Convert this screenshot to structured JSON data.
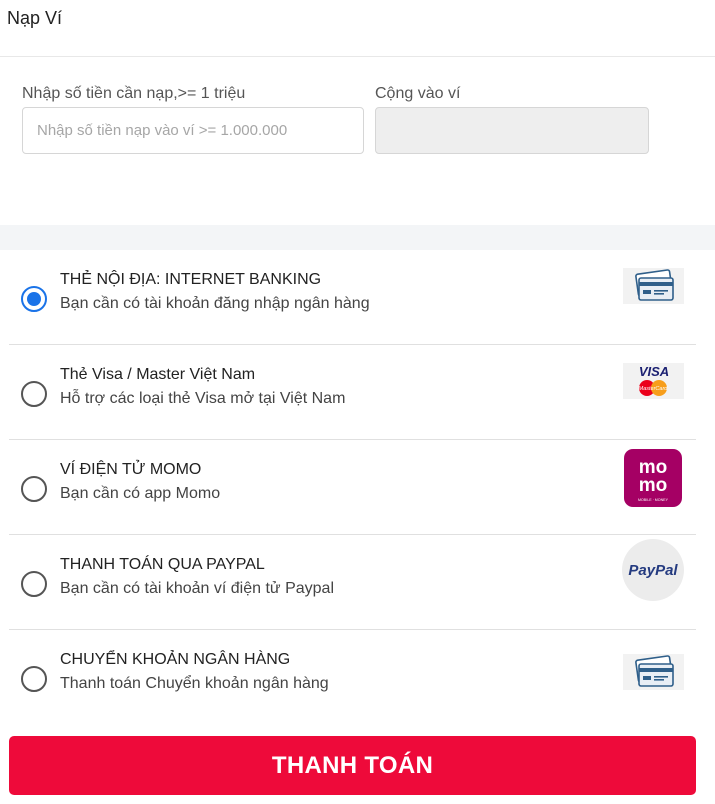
{
  "header": {
    "title": "Nạp Ví"
  },
  "amount": {
    "label": "Nhập số tiền cần nạp,>= 1 triệu",
    "placeholder": "Nhập số tiền nạp vào ví >= 1.000.000",
    "value": ""
  },
  "added": {
    "label": "Cộng vào ví",
    "value": ""
  },
  "methods": [
    {
      "title": "THẺ NỘI ĐỊA: INTERNET BANKING",
      "desc": "Bạn cần có tài khoản đăng nhập ngân hàng",
      "icon": "bank-card-icon",
      "selected": true
    },
    {
      "title": "Thẻ Visa / Master Việt Nam",
      "desc": "Hỗ trợ các loại thẻ Visa mở tại Việt Nam",
      "icon": "visa-mastercard-icon",
      "selected": false,
      "icon_text": {
        "top": "VISA",
        "bottom": "MasterCard"
      }
    },
    {
      "title": "VÍ ĐIỆN TỬ MOMO",
      "desc": "Bạn cần có app Momo",
      "icon": "momo-icon",
      "selected": false,
      "icon_text": {
        "line1": "mo",
        "line2": "mo",
        "tagline": "MOBILE · MONEY"
      }
    },
    {
      "title": "THANH TOÁN QUA PAYPAL",
      "desc": "Bạn cần có tài khoản ví điện tử Paypal",
      "icon": "paypal-icon",
      "selected": false,
      "icon_text": {
        "brand": "PayPal"
      }
    },
    {
      "title": "CHUYỂN KHOẢN NGÂN HÀNG",
      "desc": "Thanh toán Chuyển khoản ngân hàng",
      "icon": "bank-card-icon",
      "selected": false
    }
  ],
  "pay_button": {
    "label": "THANH TOÁN"
  },
  "colors": {
    "accent": "#ee0a3a",
    "radio_selected": "#1a73e8",
    "momo": "#a50064",
    "separator": "#f3f5f7"
  }
}
